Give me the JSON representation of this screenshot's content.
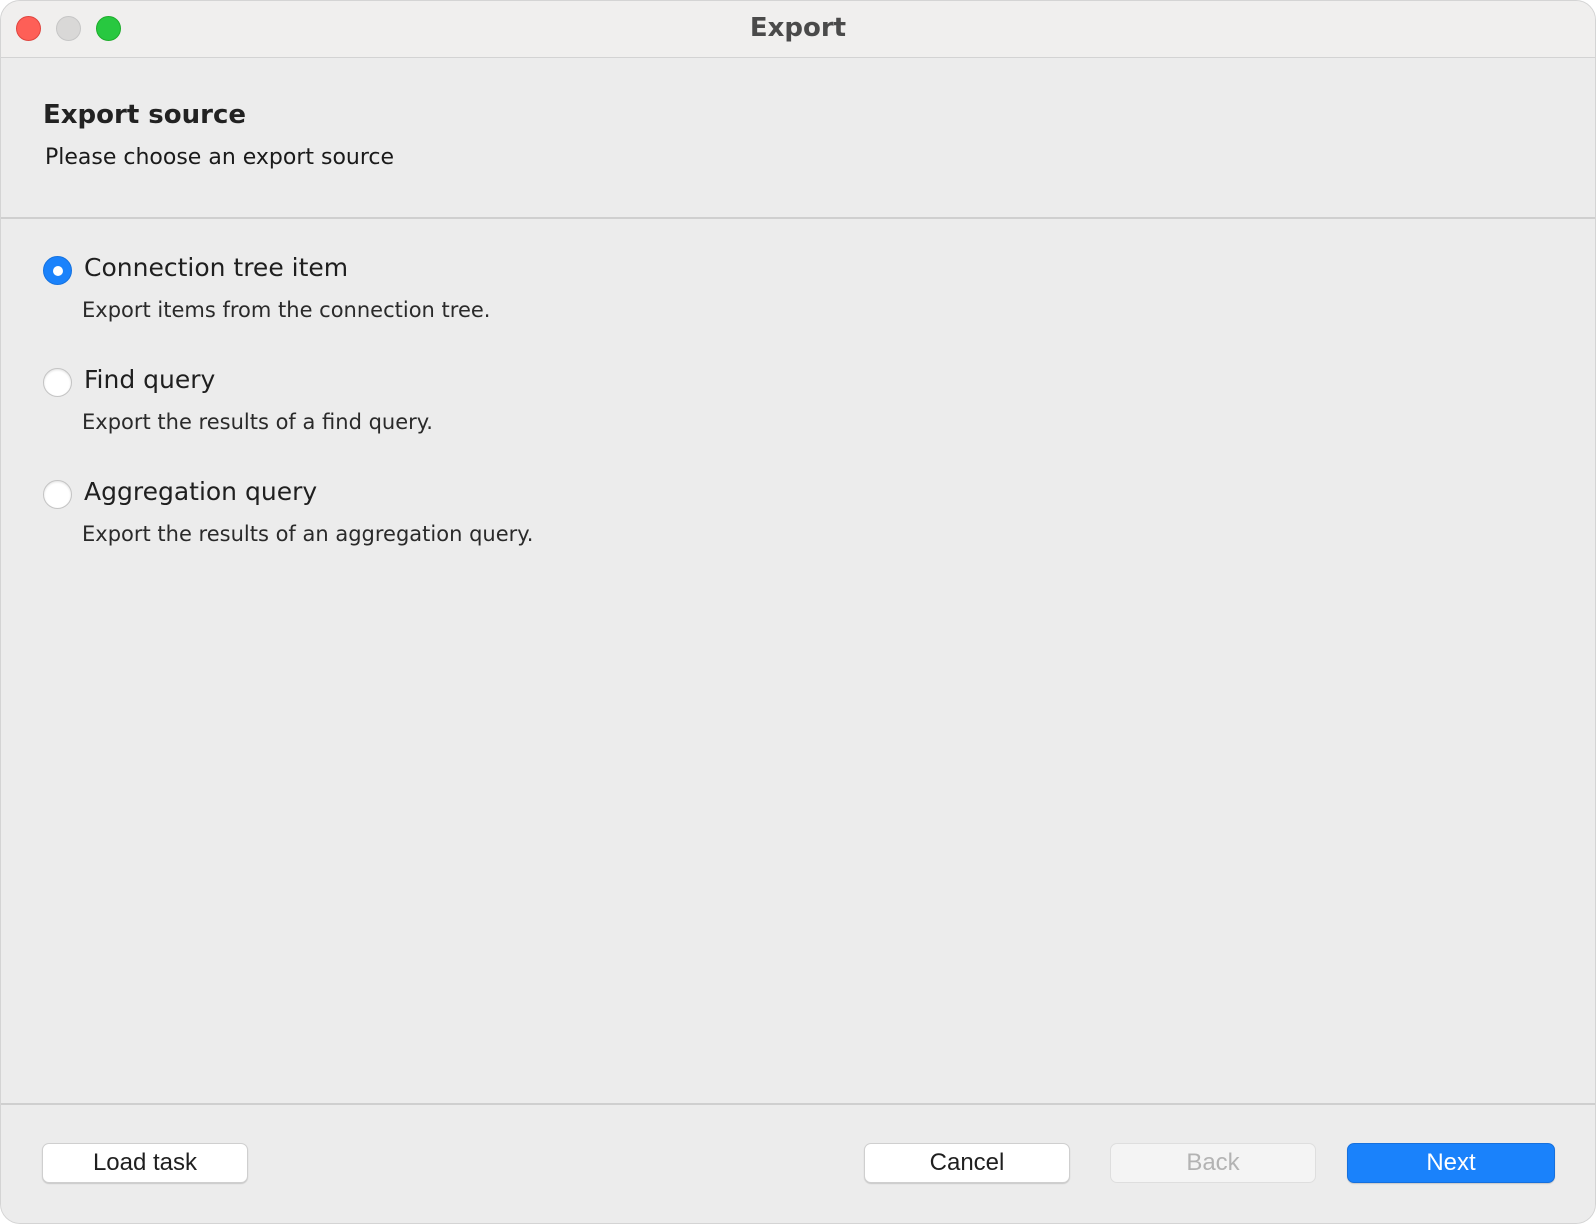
{
  "window": {
    "title": "Export"
  },
  "header": {
    "title": "Export source",
    "subtitle": "Please choose an export source"
  },
  "options": [
    {
      "label": "Connection tree item",
      "description": "Export items from the connection tree.",
      "selected": true
    },
    {
      "label": "Find query",
      "description": "Export the results of a find query.",
      "selected": false
    },
    {
      "label": "Aggregation query",
      "description": "Export the results of an aggregation query.",
      "selected": false
    }
  ],
  "footer": {
    "load_task_label": "Load task",
    "cancel_label": "Cancel",
    "back_label": "Back",
    "next_label": "Next"
  },
  "colors": {
    "accent": "#1a82fb",
    "window_bg": "#ececec",
    "close": "#fe5f57",
    "zoom": "#28c840"
  }
}
